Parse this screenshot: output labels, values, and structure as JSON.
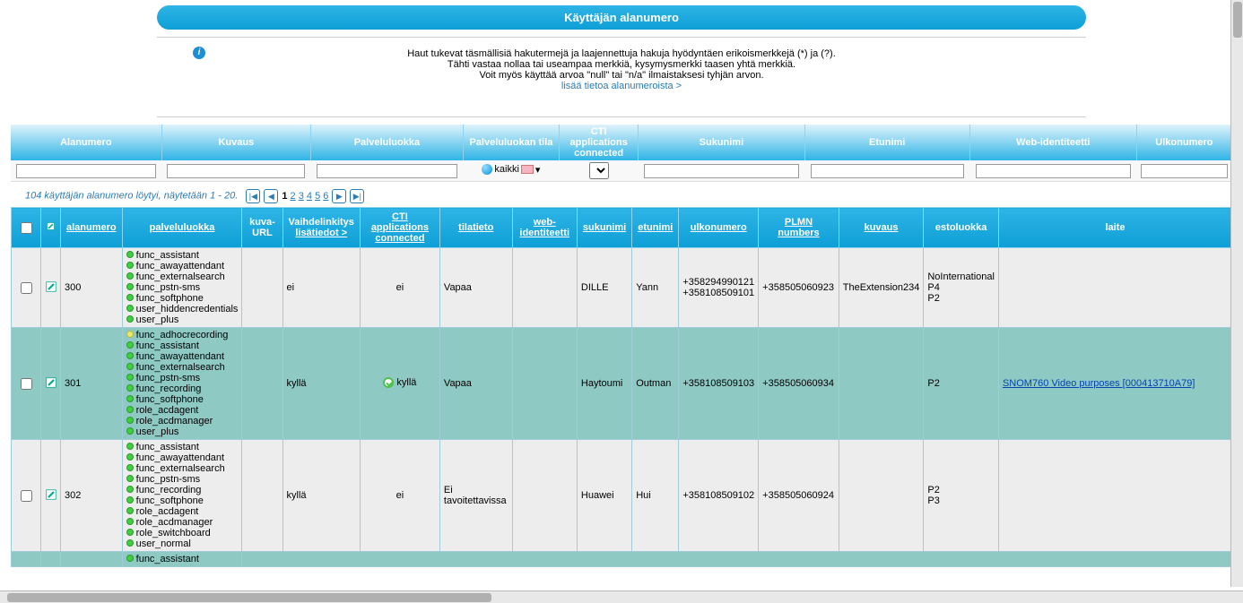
{
  "header": {
    "title": "Käyttäjän alanumero"
  },
  "help": {
    "line1": "Haut tukevat täsmällisiä hakutermejä ja laajennettuja hakuja hyödyntäen erikoismerkkejä (*) ja (?).",
    "line2": "Tähti vastaa nollaa tai useampaa merkkiä, kysymysmerkki taasen yhtä merkkiä.",
    "line3": "Voit myös käyttää arvoa \"null\" tai \"n/a\" ilmaistaksesi tyhjän arvon.",
    "link": "lisää tietoa alanumeroista >"
  },
  "filters": {
    "headers": {
      "alanumero": "Alanumero",
      "kuvaus": "Kuvaus",
      "palveluluokka": "Palveluluokka",
      "palveluluokan_tila": "Palveluluokan tila",
      "cti": "CTI applications connected",
      "sukunimi": "Sukunimi",
      "etunimi": "Etunimi",
      "web": "Web-identiteetti",
      "ulko": "Ulkonumero"
    },
    "tila_text": "kaikki"
  },
  "results": {
    "summary": "104 käyttäjän alanumero löytyi, näytetään 1 - 20.",
    "pages": [
      "1",
      "2",
      "3",
      "4",
      "5",
      "6"
    ],
    "current": "1"
  },
  "columns": {
    "alanumero": "alanumero",
    "palveluluokka": "palveluluokka",
    "kuva": "kuva-URL",
    "vaihde": "Vaihdelinkitys",
    "vaihde_sub": "lisätiedot >",
    "cti": "CTI applications connected",
    "tilatieto": "tilatieto",
    "web": "web-identiteetti",
    "sukunimi": "sukunimi",
    "etunimi": "etunimi",
    "ulko": "ulkonumero",
    "plmn": "PLMN numbers",
    "kuvaus": "kuvaus",
    "esto": "estoluokka",
    "laite": "laite"
  },
  "rows": [
    {
      "num": "300",
      "svc": [
        [
          "g",
          "func_assistant"
        ],
        [
          "g",
          "func_awayattendant"
        ],
        [
          "g",
          "func_externalsearch"
        ],
        [
          "g",
          "func_pstn-sms"
        ],
        [
          "g",
          "func_softphone"
        ],
        [
          "g",
          "user_hiddencredentials"
        ],
        [
          "g",
          "user_plus"
        ]
      ],
      "vaihde": "ei",
      "cti": "ei",
      "tila": "Vapaa",
      "web": "",
      "suku": "DILLE",
      "etu": "Yann",
      "ulko": "+358294990121\n+358108509101",
      "plmn": "+358505060923",
      "kuvaus": "TheExtension234",
      "esto": "NoInternational\nP4\nP2",
      "laite": ""
    },
    {
      "num": "301",
      "svc": [
        [
          "y",
          "func_adhocrecording"
        ],
        [
          "g",
          "func_assistant"
        ],
        [
          "g",
          "func_awayattendant"
        ],
        [
          "g",
          "func_externalsearch"
        ],
        [
          "g",
          "func_pstn-sms"
        ],
        [
          "g",
          "func_recording"
        ],
        [
          "g",
          "func_softphone"
        ],
        [
          "g",
          "role_acdagent"
        ],
        [
          "g",
          "role_acdmanager"
        ],
        [
          "g",
          "user_plus"
        ]
      ],
      "vaihde": "kyllä",
      "cti": "kyllä",
      "tila": "Vapaa",
      "web": "",
      "suku": "Haytoumi",
      "etu": "Outman",
      "ulko": "+358108509103",
      "plmn": "+358505060934",
      "kuvaus": "",
      "esto": "P2",
      "laite": "SNOM760 Video purposes [000413710A79]"
    },
    {
      "num": "302",
      "svc": [
        [
          "g",
          "func_assistant"
        ],
        [
          "g",
          "func_awayattendant"
        ],
        [
          "g",
          "func_externalsearch"
        ],
        [
          "g",
          "func_pstn-sms"
        ],
        [
          "g",
          "func_recording"
        ],
        [
          "g",
          "func_softphone"
        ],
        [
          "g",
          "role_acdagent"
        ],
        [
          "g",
          "role_acdmanager"
        ],
        [
          "g",
          "role_switchboard"
        ],
        [
          "g",
          "user_normal"
        ]
      ],
      "vaihde": "kyllä",
      "cti": "ei",
      "tila": "Ei tavoitettavissa",
      "web": "",
      "suku": "Huawei",
      "etu": "Hui",
      "ulko": "+358108509102",
      "plmn": "+358505060924",
      "kuvaus": "",
      "esto": "P2\nP3",
      "laite": ""
    }
  ],
  "partial_row_svc": "func_assistant"
}
